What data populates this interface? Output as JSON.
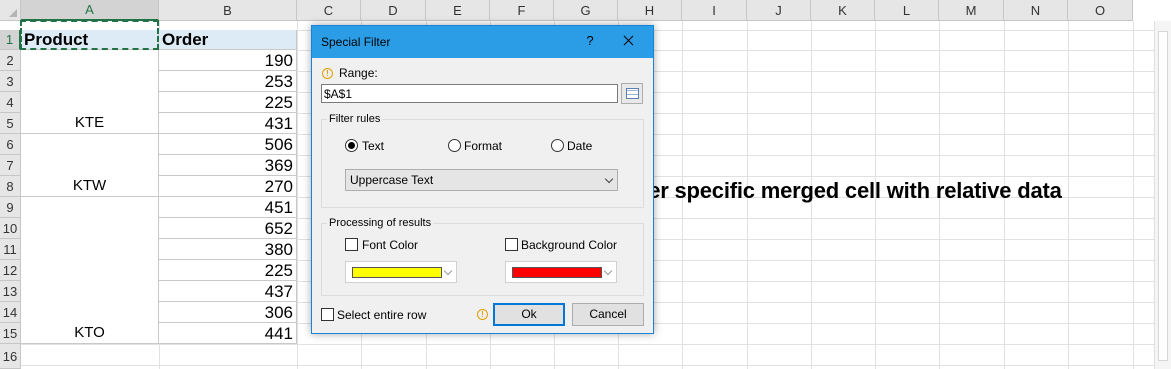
{
  "sheet": {
    "columns": [
      "A",
      "B",
      "C",
      "D",
      "E",
      "F",
      "G",
      "H",
      "I",
      "J",
      "K",
      "L",
      "M",
      "N",
      "O"
    ],
    "rows": [
      "1",
      "2",
      "3",
      "4",
      "5",
      "6",
      "7",
      "8",
      "9",
      "10",
      "11",
      "12",
      "13",
      "14",
      "15",
      "16"
    ],
    "header": {
      "product": "Product",
      "order": "Order"
    },
    "merged_groups": [
      {
        "label": "KTE"
      },
      {
        "label": "KTW"
      },
      {
        "label": "KTO"
      }
    ],
    "orders": [
      "190",
      "253",
      "225",
      "431",
      "506",
      "369",
      "270",
      "451",
      "652",
      "380",
      "225",
      "437",
      "306",
      "441"
    ]
  },
  "caption": "Filter specific merged cell with relative data",
  "dialog": {
    "title": "Special Filter",
    "help_glyph": "?",
    "range_label": "Range:",
    "range_value": "$A$1",
    "filter_rules_title": "Filter rules",
    "rule_text": "Text",
    "rule_format": "Format",
    "rule_date": "Date",
    "selected_rule": "Text",
    "rule_dropdown_value": "Uppercase Text",
    "processing_title": "Processing of results",
    "font_color_label": "Font Color",
    "background_color_label": "Background Color",
    "font_color": "#ffff00",
    "background_color": "#ff0000",
    "select_entire_row": "Select entire row",
    "ok_label": "Ok",
    "cancel_label": "Cancel"
  },
  "colors": {
    "header_fill": "#ddebf7",
    "titlebar": "#2a9de6",
    "selection_green": "#217346"
  }
}
